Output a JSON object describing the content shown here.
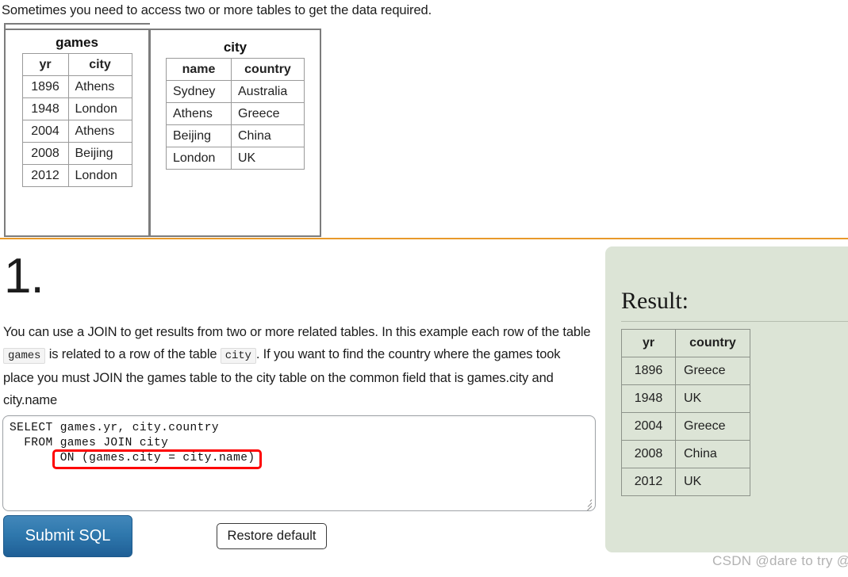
{
  "intro": {
    "text": "Sometimes you need to access two or more tables to get the data required."
  },
  "schema": {
    "games": {
      "title": "games",
      "columns": [
        "yr",
        "city"
      ],
      "rows": [
        [
          "1896",
          "Athens"
        ],
        [
          "1948",
          "London"
        ],
        [
          "2004",
          "Athens"
        ],
        [
          "2008",
          "Beijing"
        ],
        [
          "2012",
          "London"
        ]
      ]
    },
    "city": {
      "title": "city",
      "columns": [
        "name",
        "country"
      ],
      "rows": [
        [
          "Sydney",
          "Australia"
        ],
        [
          "Athens",
          "Greece"
        ],
        [
          "Beijing",
          "China"
        ],
        [
          "London",
          "UK"
        ]
      ]
    }
  },
  "lesson": {
    "number": "1.",
    "paragraph_part1": "You can use a JOIN to get results from two or more related tables. In this example each row of the table ",
    "code1": "games",
    "paragraph_part2": " is related to a row of the table ",
    "code2": "city",
    "paragraph_part3": ". If you want to find the country where the games took place you must JOIN the games table to the city table on the common field that is games.city and city.name"
  },
  "editor": {
    "sql": "SELECT games.yr, city.country\n  FROM games JOIN city\n       ON (games.city = city.name)",
    "highlight_color": "#fe0000",
    "resize_handle": "resize-grip-icon"
  },
  "buttons": {
    "submit_label": "Submit SQL",
    "restore_label": "Restore default",
    "submit_color": "#2f78ad"
  },
  "result": {
    "heading": "Result:",
    "panel_color": "#dce4d6",
    "columns": [
      "yr",
      "country"
    ],
    "rows": [
      [
        "1896",
        "Greece"
      ],
      [
        "1948",
        "UK"
      ],
      [
        "2004",
        "Greece"
      ],
      [
        "2008",
        "China"
      ],
      [
        "2012",
        "UK"
      ]
    ]
  },
  "divider": {
    "color": "#e8992a"
  },
  "watermark": {
    "text": "CSDN @dare to try @"
  }
}
